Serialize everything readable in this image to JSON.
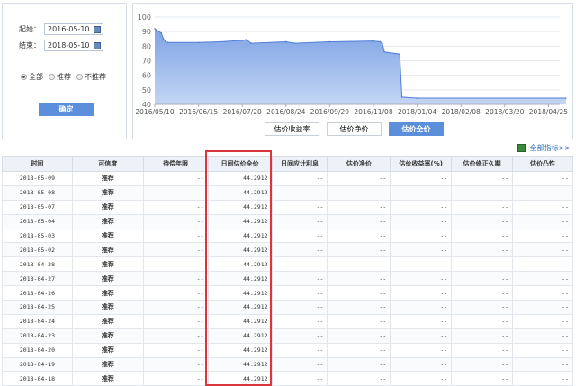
{
  "filter": {
    "start_label": "起始：",
    "start_value": "2016-05-10",
    "end_label": "结束：",
    "end_value": "2018-05-10",
    "radios": [
      "全部",
      "推荐",
      "不推荐"
    ],
    "selected": "全部",
    "confirm": "确定"
  },
  "chart_buttons": [
    "估价收益率",
    "估价净价",
    "估价全价"
  ],
  "active_chart_button": "估价全价",
  "all_indicators": "全部指标>>",
  "colors": {
    "accent": "#5b8edb",
    "highlight": "#d9363e"
  },
  "chart_data": {
    "type": "area",
    "title": "",
    "xlabel": "",
    "ylabel": "",
    "ylim": [
      40,
      100
    ],
    "yticks": [
      40,
      50,
      60,
      70,
      80,
      90,
      100
    ],
    "xticks": [
      "2016/05/10",
      "2016/06/15",
      "2016/07/20",
      "2016/08/24",
      "2016/09/29",
      "2016/11/08",
      "2018/01/04",
      "2018/02/08",
      "2018/03/20",
      "2018/04/25"
    ],
    "series": [
      {
        "name": "估价全价",
        "x_tick_pos": [
          0,
          0.05,
          0.15,
          0.2,
          0.25,
          0.3,
          1,
          1.5,
          2,
          2.1,
          2.2,
          3,
          3.2,
          4,
          5,
          5.15,
          5.2,
          5.25,
          5.6,
          5.65,
          6,
          9.4
        ],
        "values": [
          92,
          91,
          89,
          85,
          83,
          82.5,
          82.5,
          83,
          84,
          84.5,
          82,
          83,
          82,
          83,
          83.5,
          83,
          82,
          76,
          74.5,
          45,
          44.3,
          44.3
        ]
      }
    ]
  },
  "table": {
    "headers": [
      "时间",
      "可信度",
      "待偿年限",
      "日间估价全价",
      "日间应计利息",
      "估价净价",
      "估价收益率(%)",
      "估价修正久期",
      "估价凸性"
    ],
    "rows": [
      [
        "2018-05-09",
        "推荐",
        "--",
        "44.2912",
        "--",
        "--",
        "--",
        "--",
        "--"
      ],
      [
        "2018-05-08",
        "推荐",
        "--",
        "44.2912",
        "--",
        "--",
        "--",
        "--",
        "--"
      ],
      [
        "2018-05-07",
        "推荐",
        "--",
        "44.2912",
        "--",
        "--",
        "--",
        "--",
        "--"
      ],
      [
        "2018-05-04",
        "推荐",
        "--",
        "44.2912",
        "--",
        "--",
        "--",
        "--",
        "--"
      ],
      [
        "2018-05-03",
        "推荐",
        "--",
        "44.2912",
        "--",
        "--",
        "--",
        "--",
        "--"
      ],
      [
        "2018-05-02",
        "推荐",
        "--",
        "44.2912",
        "--",
        "--",
        "--",
        "--",
        "--"
      ],
      [
        "2018-04-28",
        "推荐",
        "--",
        "44.2912",
        "--",
        "--",
        "--",
        "--",
        "--"
      ],
      [
        "2018-04-27",
        "推荐",
        "--",
        "44.2912",
        "--",
        "--",
        "--",
        "--",
        "--"
      ],
      [
        "2018-04-26",
        "推荐",
        "--",
        "44.2912",
        "--",
        "--",
        "--",
        "--",
        "--"
      ],
      [
        "2018-04-25",
        "推荐",
        "--",
        "44.2912",
        "--",
        "--",
        "--",
        "--",
        "--"
      ],
      [
        "2018-04-24",
        "推荐",
        "--",
        "44.2912",
        "--",
        "--",
        "--",
        "--",
        "--"
      ],
      [
        "2018-04-23",
        "推荐",
        "--",
        "44.2912",
        "--",
        "--",
        "--",
        "--",
        "--"
      ],
      [
        "2018-04-20",
        "推荐",
        "--",
        "44.2912",
        "--",
        "--",
        "--",
        "--",
        "--"
      ],
      [
        "2018-04-19",
        "推荐",
        "--",
        "44.2912",
        "--",
        "--",
        "--",
        "--",
        "--"
      ],
      [
        "2018-04-18",
        "推荐",
        "--",
        "44.2912",
        "--",
        "--",
        "--",
        "--",
        "--"
      ]
    ]
  }
}
